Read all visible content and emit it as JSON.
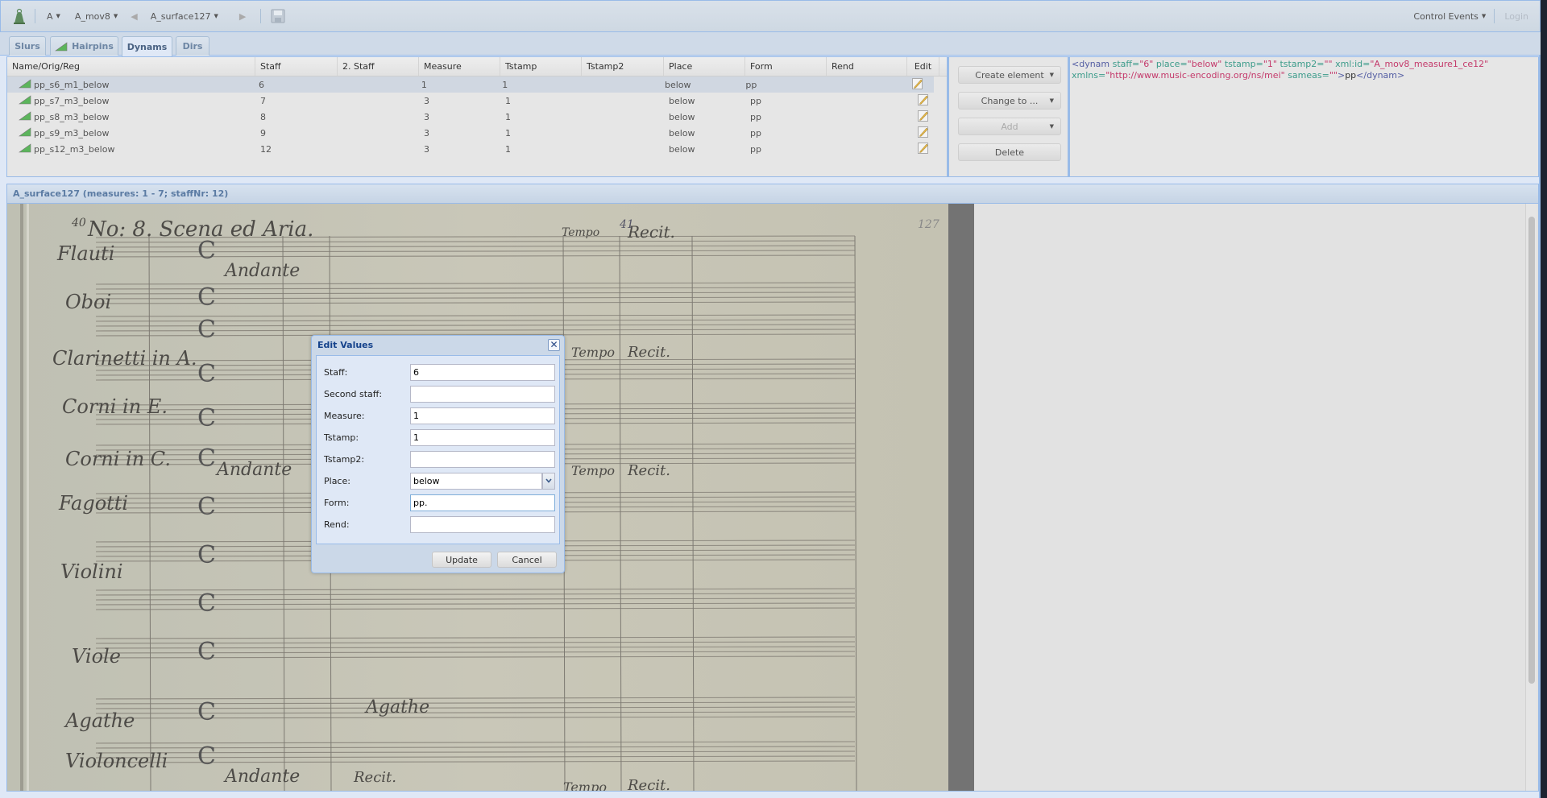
{
  "toolbar": {
    "source_label": "A",
    "movement_label": "A_mov8",
    "surface_label": "A_surface127",
    "control_events_label": "Control Events",
    "login_label": "Login"
  },
  "tabs": [
    {
      "label": "Slurs",
      "active": false
    },
    {
      "label": "Hairpins",
      "active": false
    },
    {
      "label": "Dynams",
      "active": true
    },
    {
      "label": "Dirs",
      "active": false
    }
  ],
  "grid": {
    "columns": [
      "Name/Orig/Reg",
      "Staff",
      "2. Staff",
      "Measure",
      "Tstamp",
      "Tstamp2",
      "Place",
      "Form",
      "Rend",
      "Edit"
    ],
    "rows": [
      {
        "name": "pp_s6_m1_below",
        "staff": "6",
        "staff2": "",
        "measure": "1",
        "tstamp": "1",
        "tstamp2": "",
        "place": "below",
        "form": "pp",
        "rend": "",
        "selected": true
      },
      {
        "name": "pp_s7_m3_below",
        "staff": "7",
        "staff2": "",
        "measure": "3",
        "tstamp": "1",
        "tstamp2": "",
        "place": "below",
        "form": "pp",
        "rend": "",
        "selected": false
      },
      {
        "name": "pp_s8_m3_below",
        "staff": "8",
        "staff2": "",
        "measure": "3",
        "tstamp": "1",
        "tstamp2": "",
        "place": "below",
        "form": "pp",
        "rend": "",
        "selected": false
      },
      {
        "name": "pp_s9_m3_below",
        "staff": "9",
        "staff2": "",
        "measure": "3",
        "tstamp": "1",
        "tstamp2": "",
        "place": "below",
        "form": "pp",
        "rend": "",
        "selected": false
      },
      {
        "name": "pp_s12_m3_below",
        "staff": "12",
        "staff2": "",
        "measure": "3",
        "tstamp": "1",
        "tstamp2": "",
        "place": "below",
        "form": "pp",
        "rend": "",
        "selected": false
      }
    ]
  },
  "actions": {
    "create_label": "Create element",
    "change_label": "Change to ...",
    "add_label": "Add",
    "delete_label": "Delete"
  },
  "xml_preview": {
    "tag_open": "<dynam",
    "attrs": [
      {
        "name": "staff",
        "value": "\"6\""
      },
      {
        "name": "place",
        "value": "\"below\""
      },
      {
        "name": "tstamp",
        "value": "\"1\""
      },
      {
        "name": "tstamp2",
        "value": "\"\""
      },
      {
        "name": "xml:id",
        "value": "\"A_mov8_measure1_ce12\""
      },
      {
        "name": "xmlns",
        "value": "\"http://www.music-encoding.org/ns/mei\""
      },
      {
        "name": "sameas",
        "value": "\"\""
      }
    ],
    "tag_close_start": ">",
    "content": "pp",
    "tag_end": "</dynam>"
  },
  "facsimile": {
    "header": "A_surface127 (measures: 1 - 7; staffNr: 12)",
    "manuscript_texts": {
      "title": "No: 8. Scena ed Aria.",
      "page_number": "40",
      "folio": "127",
      "tempo_marks": [
        "Andante",
        "Tempo",
        "Recit."
      ],
      "measure_number": "41",
      "instruments": [
        "Flauti",
        "Oboi",
        "Clarinetti in A.",
        "Corni in E.",
        "Corni in C.",
        "Fagotti",
        "Violini",
        "Viole",
        "Agathe",
        "Violoncelli"
      ]
    }
  },
  "dialog": {
    "title": "Edit Values",
    "fields": [
      {
        "label": "Staff:",
        "value": "6"
      },
      {
        "label": "Second staff:",
        "value": ""
      },
      {
        "label": "Measure:",
        "value": "1"
      },
      {
        "label": "Tstamp:",
        "value": "1"
      },
      {
        "label": "Tstamp2:",
        "value": ""
      },
      {
        "label": "Place:",
        "value": "below"
      },
      {
        "label": "Form:",
        "value": "pp."
      },
      {
        "label": "Rend:",
        "value": ""
      }
    ],
    "update_label": "Update",
    "cancel_label": "Cancel"
  },
  "colors": {
    "accent": "#99bbe8",
    "title_blue": "#15428b",
    "xml_tag": "#545ea3",
    "xml_attr": "#3d9c8b",
    "xml_value": "#c43a6b",
    "hairpin_green": "#5bb55b"
  }
}
